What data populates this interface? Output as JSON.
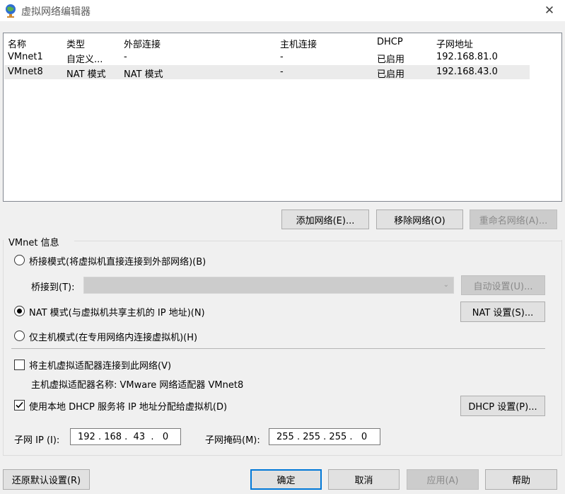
{
  "window": {
    "title": "虚拟网络编辑器",
    "close_glyph": "✕"
  },
  "table": {
    "columns": [
      "名称",
      "类型",
      "外部连接",
      "主机连接",
      "DHCP",
      "子网地址"
    ],
    "rows": [
      [
        "VMnet1",
        "自定义...",
        "-",
        "-",
        "已启用",
        "192.168.81.0"
      ],
      [
        "VMnet8",
        "NAT 模式",
        "NAT 模式",
        "-",
        "已启用",
        "192.168.43.0"
      ]
    ],
    "selected_row": 1
  },
  "list_buttons": {
    "add": "添加网络(E)...",
    "remove": "移除网络(O)",
    "rename": "重命名网络(A)..."
  },
  "vmnet_info": {
    "title": "VMnet 信息",
    "bridge_mode": "桥接模式(将虚拟机直接连接到外部网络)(B)",
    "bridge_to_label": "桥接到(T):",
    "bridge_to_value": "",
    "auto_settings": "自动设置(U)...",
    "nat_mode": "NAT 模式(与虚拟机共享主机的 IP 地址)(N)",
    "nat_settings": "NAT 设置(S)...",
    "host_only": "仅主机模式(在专用网络内连接虚拟机)(H)",
    "selected_mode": "nat",
    "connect_adapter": "将主机虚拟适配器连接到此网络(V)",
    "connect_adapter_checked": false,
    "adapter_name_label": "主机虚拟适配器名称: VMware 网络适配器 VMnet8",
    "use_dhcp": "使用本地 DHCP 服务将 IP 地址分配给虚拟机(D)",
    "use_dhcp_checked": true,
    "dhcp_settings": "DHCP 设置(P)...",
    "subnet_ip_label": "子网 IP (I):",
    "subnet_ip": "192 . 168 .  43  .   0",
    "subnet_mask_label": "子网掩码(M):",
    "subnet_mask": "255 . 255 . 255 .   0"
  },
  "footer": {
    "restore": "还原默认设置(R)",
    "ok": "确定",
    "cancel": "取消",
    "apply": "应用(A)",
    "help": "帮助"
  },
  "colors": {
    "selected_row": "#ebebeb",
    "disabled_button": "#cccccc",
    "primary_border": "#0078d7"
  }
}
